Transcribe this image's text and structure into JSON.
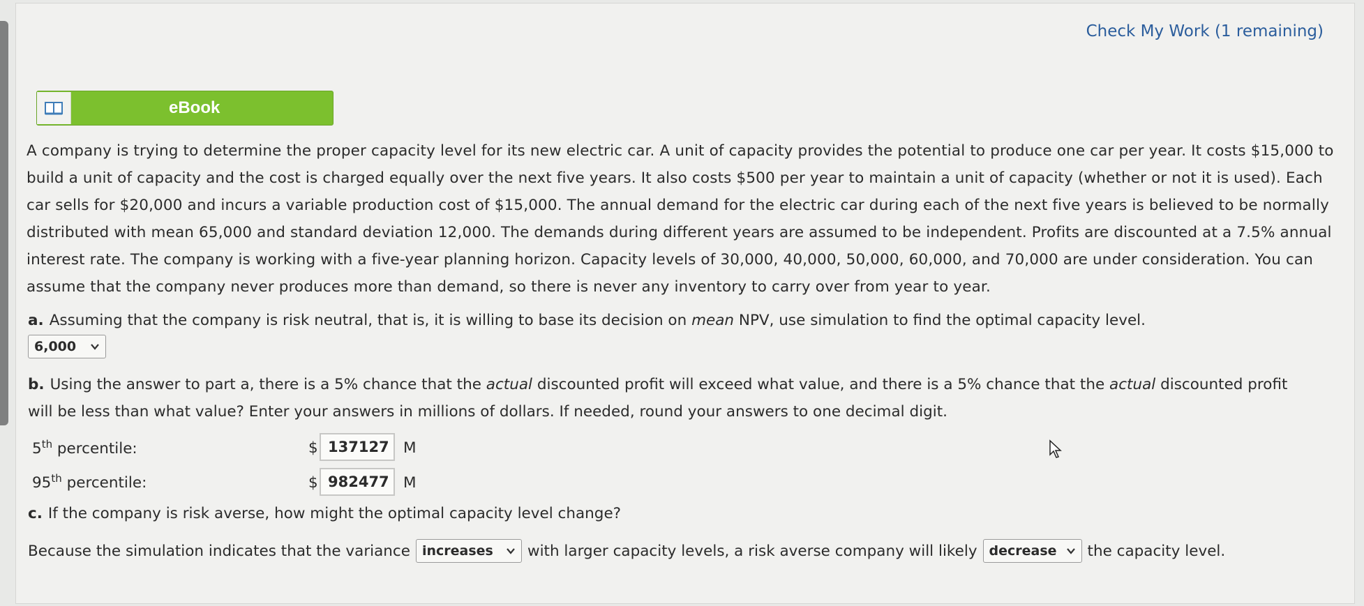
{
  "header": {
    "check_work": "Check My Work (1 remaining)"
  },
  "ebook": {
    "label": "eBook",
    "icon": "book-icon"
  },
  "problem": {
    "text": "A company is trying to determine the proper capacity level for its new electric car. A unit of capacity provides the potential to produce one car per year. It costs $15,000 to build a unit of capacity and the cost is charged equally over the next five years. It also costs $500 per year to maintain a unit of capacity (whether or not it is used). Each car sells for $20,000 and incurs a variable production cost of $15,000. The annual demand for the electric car during each of the next five years is believed to be normally distributed with mean 65,000 and standard deviation 12,000. The demands during different years are assumed to be independent. Profits are discounted at a 7.5% annual interest rate. The company is working with a five-year planning horizon. Capacity levels of 30,000, 40,000, 50,000, 60,000, and 70,000 are under consideration. You can assume that the company never produces more than demand, so there is never any inventory to carry over from year to year."
  },
  "part_a": {
    "letter": "a.",
    "text_before": "Assuming that the company is risk neutral, that is, it is willing to base its decision on ",
    "text_em": "mean",
    "text_after": " NPV, use simulation to find the optimal capacity level.",
    "selected": "6,000"
  },
  "part_b": {
    "letter": "b.",
    "t1": "Using the answer to part a, there is a 5% chance that the ",
    "em1": "actual",
    "t2": " discounted profit will exceed what value, and there is a 5% chance that the ",
    "em2": "actual",
    "t3": " discounted profit will be less than what value? Enter your answers in millions of dollars. If needed, round your answers to one decimal digit.",
    "p5_num": "5",
    "p5_sup": "th",
    "p5_label": " percentile:",
    "p5_value": "137127",
    "p95_num": "95",
    "p95_sup": "th",
    "p95_label": " percentile:",
    "p95_value": "982477",
    "currency": "$",
    "unit": "M"
  },
  "part_c": {
    "letter": "c.",
    "question": "If the company is risk averse, how might the optimal capacity level change?",
    "s1": "Because the simulation indicates that the variance",
    "select1": "increases",
    "s2": "with larger capacity levels, a risk averse company will likely",
    "select2": "decrease",
    "s3": "the capacity level."
  },
  "colors": {
    "link": "#2b5d9c",
    "ebook_green": "#7cc02e"
  }
}
